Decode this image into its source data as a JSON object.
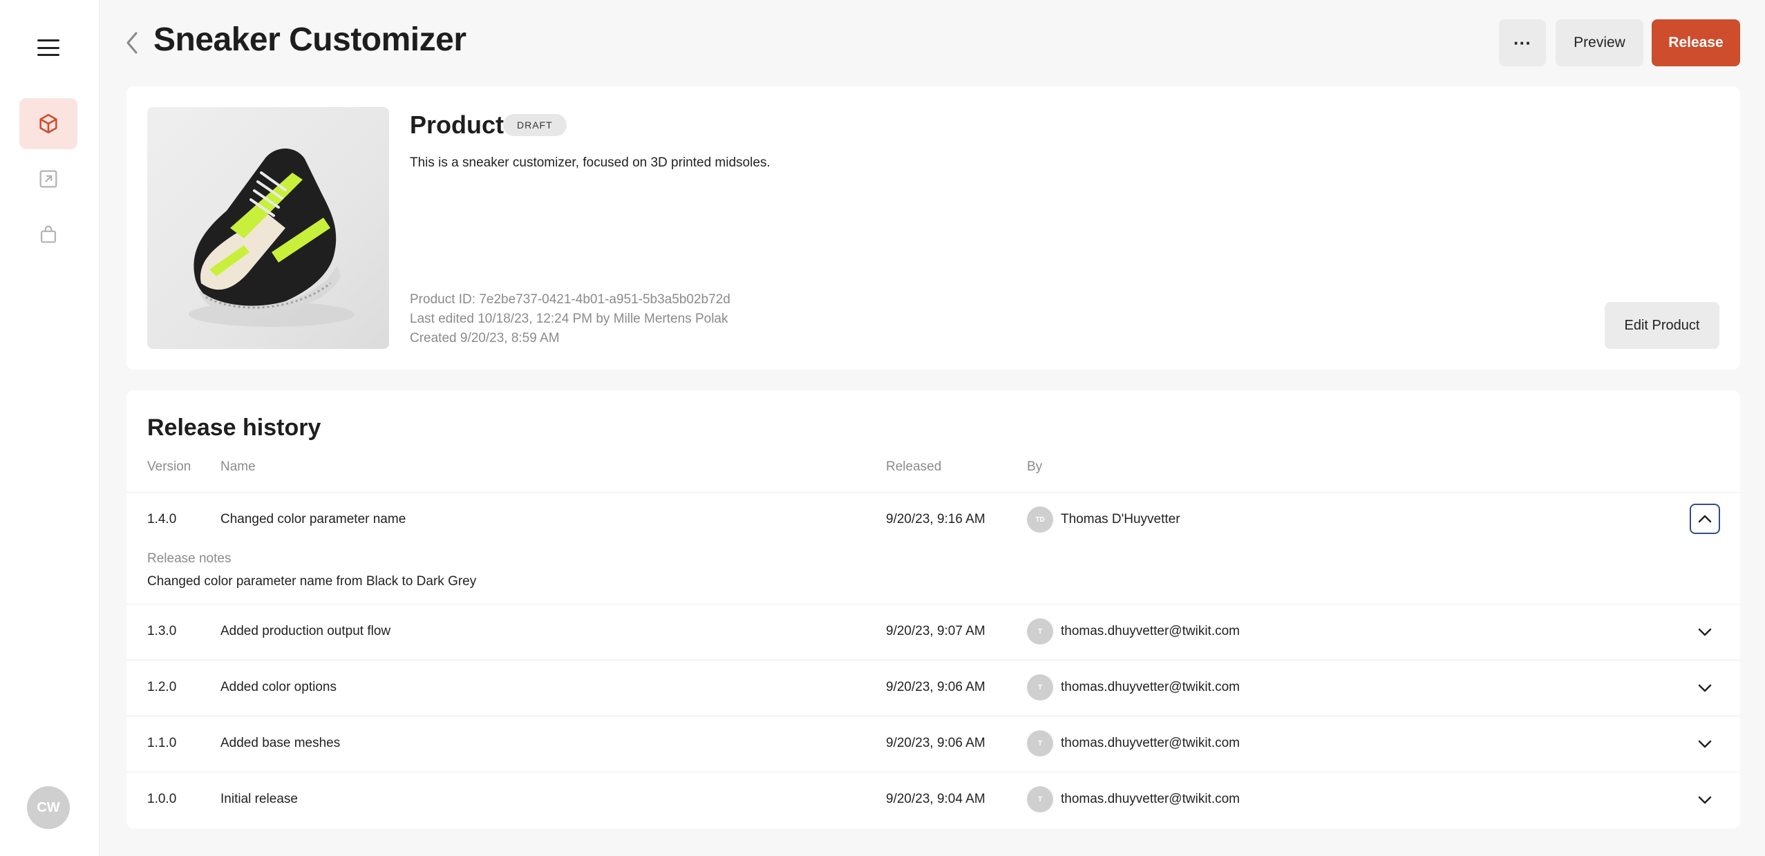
{
  "sidebar": {
    "user_initials": "CW"
  },
  "header": {
    "title": "Sneaker Customizer",
    "more_label": "···",
    "preview_label": "Preview",
    "release_label": "Release"
  },
  "product": {
    "heading": "Product",
    "status": "DRAFT",
    "description": "This is a sneaker customizer, focused on 3D printed midsoles.",
    "product_id": "Product ID: 7e2be737-0421-4b01-a951-5b3a5b02b72d",
    "last_edited": "Last edited 10/18/23, 12:24 PM by Mille Mertens Polak",
    "created": "Created 9/20/23, 8:59 AM",
    "edit_label": "Edit Product"
  },
  "history": {
    "title": "Release history",
    "columns": {
      "version": "Version",
      "name": "Name",
      "released": "Released",
      "by": "By"
    },
    "rows": [
      {
        "version": "1.4.0",
        "name": "Changed color parameter name",
        "released": "9/20/23, 9:16 AM",
        "initials": "TD",
        "by": "Thomas D'Huyvetter",
        "notes_label": "Release notes",
        "notes": "Changed color parameter name from Black to Dark Grey"
      },
      {
        "version": "1.3.0",
        "name": "Added production output flow",
        "released": "9/20/23, 9:07 AM",
        "initials": "T",
        "by": "thomas.dhuyvetter@twikit.com"
      },
      {
        "version": "1.2.0",
        "name": "Added color options",
        "released": "9/20/23, 9:06 AM",
        "initials": "T",
        "by": "thomas.dhuyvetter@twikit.com"
      },
      {
        "version": "1.1.0",
        "name": "Added base meshes",
        "released": "9/20/23, 9:06 AM",
        "initials": "T",
        "by": "thomas.dhuyvetter@twikit.com"
      },
      {
        "version": "1.0.0",
        "name": "Initial release",
        "released": "9/20/23, 9:04 AM",
        "initials": "T",
        "by": "thomas.dhuyvetter@twikit.com"
      }
    ]
  }
}
